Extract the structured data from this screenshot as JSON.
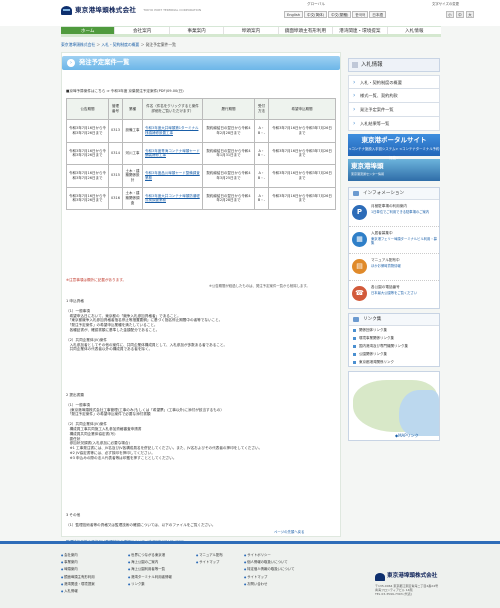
{
  "header": {
    "company": "東京港埠頭株式会社",
    "company_en": "TOKYO PORT TERMINAL CORPORATION",
    "global": "グローバル",
    "languages": [
      "English",
      "中文(简体)",
      "中文(繁體)",
      "한국어",
      "日本語"
    ],
    "font_size_label": "文字サイズの変更",
    "font_sizes": [
      "小",
      "中",
      "大"
    ]
  },
  "gnav": [
    "ホーム",
    "会社案内",
    "事業案内",
    "埠頭案内",
    "鏡面埠頭主有形利用",
    "港湾関連・環境提案",
    "入札情報"
  ],
  "breadcrumb": [
    "東京港埠頭株式会社",
    "入札・契約制度の概要",
    "発注予定案件一覧"
  ],
  "page_title": "発注予定案件一覧",
  "notice": "■京埠予算案件はこちら ⇒ 令和3年度 京葉発注予定案件(PDF)09.00(日)",
  "table": {
    "headers": [
      "公告期間",
      "管理番号",
      "業種",
      "件名（件名をクリックすると案件詳細をご覧いただけます）",
      "履行期間",
      "受付方法",
      "希望申込期間"
    ],
    "rows": [
      [
        "令和3年7月16日から令和3年7月26日まで",
        "0313",
        "設備工事",
        "令和3年度大井埠頭第1ターミナル桟橋補修設置工事",
        "契約締結日の翌日から令和4年2月28日まで",
        "A・B・-",
        "令和3年7月16日から令和3年7月26日まで"
      ],
      [
        "令和3年7月16日から令和3年7月26日まで",
        "0314",
        "河川工事",
        "令和3年度青海コンテナ埠頭ヤード舗装補修工事",
        "契約締結日の翌日から令和4年1月31日まで",
        "A・B・-",
        "令和3年7月16日から令和3年7月26日まで"
      ],
      [
        "令和3年7月16日から令和3年7月26日まで",
        "0315",
        "土木・建築関係設計",
        "令和3年度品川埠頭ヤード整備調査業務",
        "契約締結日の翌日から令和4年3月25日まで",
        "A・B・-",
        "令和3年7月16日から令和3年7月26日まで"
      ],
      [
        "令和3年7月16日から令和3年7月26日まで",
        "0316",
        "土木・建築関係調査",
        "令和3年度大井コンテナ埠頭防潮堤点検調査業務",
        "契約締結日の翌日から令和4年2月28日まで",
        "A・B・-",
        "令和3年7月16日から令和3年7月26日まで"
      ]
    ]
  },
  "warn": "※注意事項は欄外に記載があります。",
  "note": "※公告期間が経過したものは、発注予定案件一覧から削除します。",
  "sections": {
    "s1": "1 申込資格\n\n（1）一般事項\n　希望申込日において、東京都の「競争入札参加資格者」であること。\n　「東京都競争入札参加資格者指名停止等措置要綱」に基づく指名停止期間中の者等でないこと。\n　「発注予定案件」の希望申込業種を満たしていること。\n　各種証書が、確認書類に基準した金額配分であること。\n\n（2）共同企業体(JV)案件\n　入札参加者としてその他の案件に、共同企業体構成員として、入札参加が多数ある者であること。\n　共同企業体の代表者以外の構成員である者を除く。",
    "s2": "2 提出書類\n\n（1）一般事項\n　(東京港埠頭株式会社工事管理)工事のみ(もしくは「希望票」(工事以外)に添付が該当するもの）\n　「発注予定案件」の希望申込案件で必要な添付書類\n\n（2）共同企業体(JV)案件\n　構成員工事共同施工入札参加資格審査申請書\n　構成員共同企業体協定書(写)\n　委任状\n　参加状況調書(入札参加に必要な場合)\n　※1 工事発注書には、JV名及びJV各構成員名を併記してください。また、JV名およびその代表者の押印をしてください。\n　※2 JV協定書等には、必ず捺印を押印してください。\n　※3 申込みの際の法人代表者等は印鑑を押すこととしてください。",
    "s3": "3 その他\n\n（1）監理技術者等の資格又は監理技術の確認については、以下のファイルをご覧ください。",
    "s3_link": "監理技術者等の資格又は監理技術の確認について（令和3年6月1日)(PDF)"
  },
  "page_top": "ページの先頭へ戻る",
  "sidebar": {
    "head": "入札情報",
    "items": [
      "入札・契約制度の概要",
      "様式一覧、契約約款",
      "発注予定案件一覧",
      "入札結果等一覧"
    ],
    "banner1": "東京港ポータルサイト",
    "banner1_sub": "<コンテナ施設入手割システム>\n<コンテナターミナル予約機能>",
    "banner2": "東京港埠頭",
    "banner2_sub": "東京港流通センター情報",
    "info_head": "インフォメーション",
    "info": [
      {
        "t": "月極駐車場の利用案内",
        "s": "1日単位でご利用できる駐車場のご案内",
        "ico": "P",
        "color": "#2d6cb8"
      },
      {
        "t": "入居者募集中",
        "s": "東京港フェリー埠頭ターミナルビル利用・募集",
        "ico": "▦",
        "color": "#2f7fc8"
      },
      {
        "t": "マニュアル配布中",
        "s": "ほかお帰時貨物情報",
        "ico": "▤",
        "color": "#e08a2a"
      },
      {
        "t": "各公園の電話番号",
        "s": "日本最大公園等をご覧ください",
        "ico": "☎",
        "color": "#d25a3a"
      }
    ],
    "links_head": "リンク集",
    "links": [
      "関係団体リンク集",
      "環境事業関係リンク集",
      "国内港湾及び専門機関リンク集",
      "公園関係リンク集",
      "東京都港湾関係リンク"
    ],
    "map_label": "◆MAPリンク"
  },
  "footer": {
    "col1": [
      "会社案内",
      "事業案内",
      "埠頭案内",
      "鏡面埠頭主有形利用",
      "港湾関連・環境提案",
      "入札情報"
    ],
    "col2": [
      "世界につながる東京港",
      "海上公園のご案内",
      "海上公園利用者等一覧",
      "港湾ターミナル利用者情報",
      "リンク集"
    ],
    "col3": [
      "マニュアル配布",
      "サイトマップ"
    ],
    "col4": [
      "サイトポリシー",
      "個人情報の取扱いについて",
      "特定個人情報の取扱いについて",
      "サイトマップ",
      "お問い合わせ"
    ],
    "company": "東京港埠頭株式会社",
    "address": "〒135-0064 東京都江東区青海二丁目4番24号\n青海フロンティアビル 14階\nTEL 03-3599-7303 (代表)"
  }
}
